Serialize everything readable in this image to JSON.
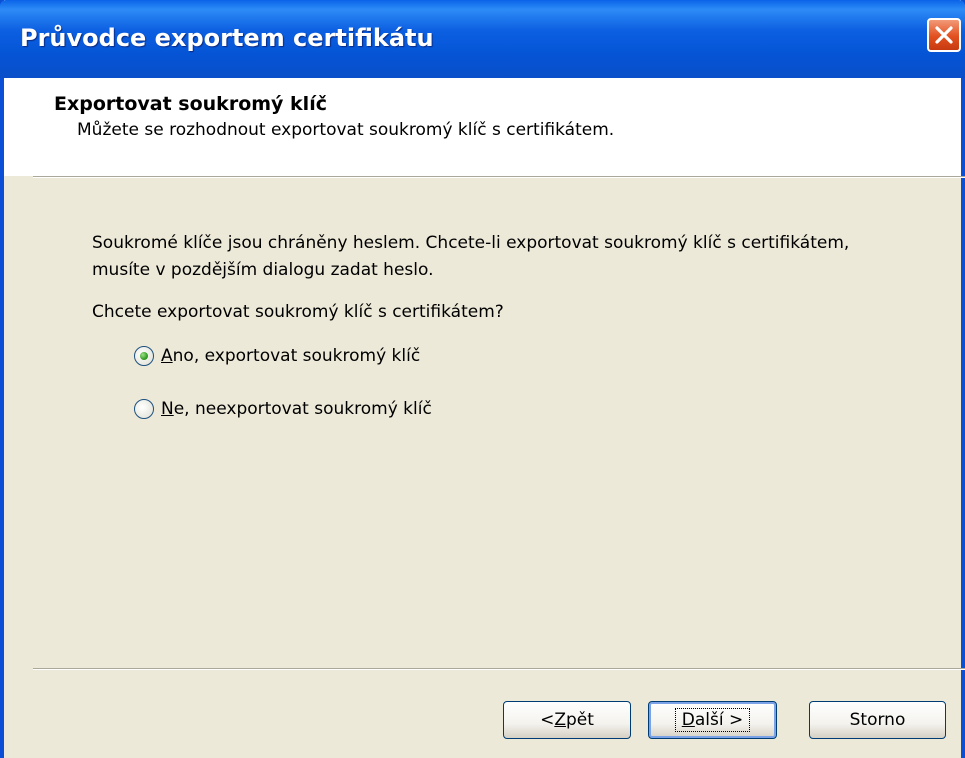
{
  "window": {
    "title": "Průvodce exportem certifikátu"
  },
  "header": {
    "title": "Exportovat soukromý klíč",
    "subtitle": "Můžete se rozhodnout exportovat soukromý klíč s certifikátem."
  },
  "body": {
    "description": "Soukromé klíče jsou chráněny heslem. Chcete-li exportovat soukromý klíč s certifikátem, musíte v pozdějším dialogu zadat heslo.",
    "question": "Chcete exportovat soukromý klíč s certifikátem?"
  },
  "options": [
    {
      "mnemonic": "A",
      "rest": "no, exportovat soukromý klíč",
      "selected": true
    },
    {
      "mnemonic": "N",
      "rest": "e, neexportovat soukromý klíč",
      "selected": false
    }
  ],
  "buttons": {
    "back": {
      "prefix": "< ",
      "mnemonic": "Z",
      "rest": "pět"
    },
    "next": {
      "mnemonic": "D",
      "rest": "alší >"
    },
    "cancel": {
      "label": "Storno"
    }
  },
  "colors": {
    "titlebar": "#0554d6",
    "dialog_bg": "#ece9d8",
    "close_button": "#e2501f",
    "radio_selected": "#35a024"
  },
  "icons": {
    "close": "close-icon"
  }
}
